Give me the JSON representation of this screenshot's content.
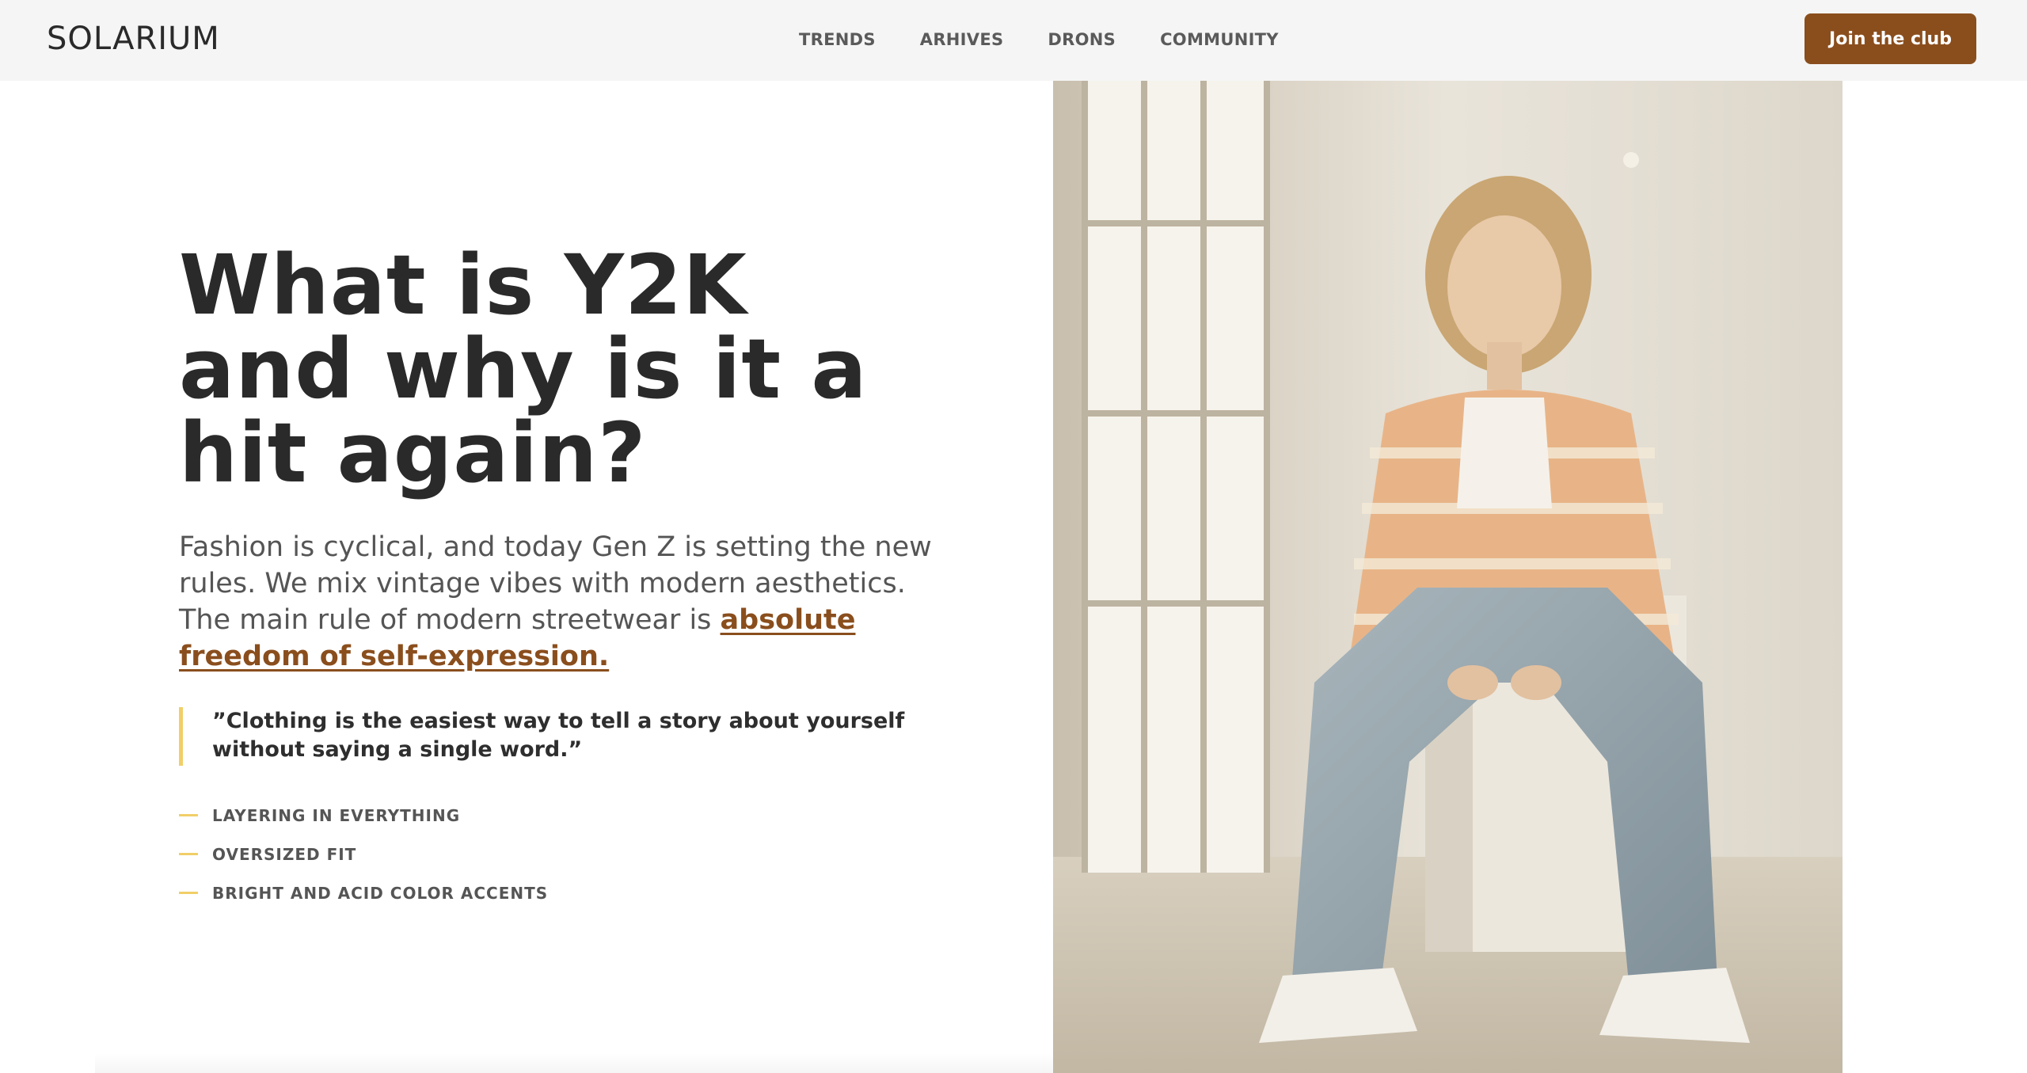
{
  "header": {
    "logo": "SOLARIUM",
    "nav": [
      "TRENDS",
      "ARHIVES",
      "DRONS",
      "COMMUNITY"
    ],
    "cta": "Join the club"
  },
  "hero": {
    "headline": "What is Y2K and why is it a hit again?",
    "intro_text": "Fashion is cyclical, and today Gen Z is setting the new rules. We mix vintage vibes with modern aesthetics. The main rule of modern streetwear is",
    "intro_link": "absolute freedom of self-expression.",
    "quote": "”Clothing is the easiest way to tell a story about yourself without saying a single word.”",
    "points": [
      "LAYERING IN EVERYTHING",
      "OVERSIZED FIT",
      "BRIGHT AND ACID COLOR ACCENTS"
    ]
  },
  "colors": {
    "accent": "#8a4e1d",
    "highlight": "#f1cf68",
    "topbar": "#f5f5f5",
    "text": "#2a2a2a"
  }
}
